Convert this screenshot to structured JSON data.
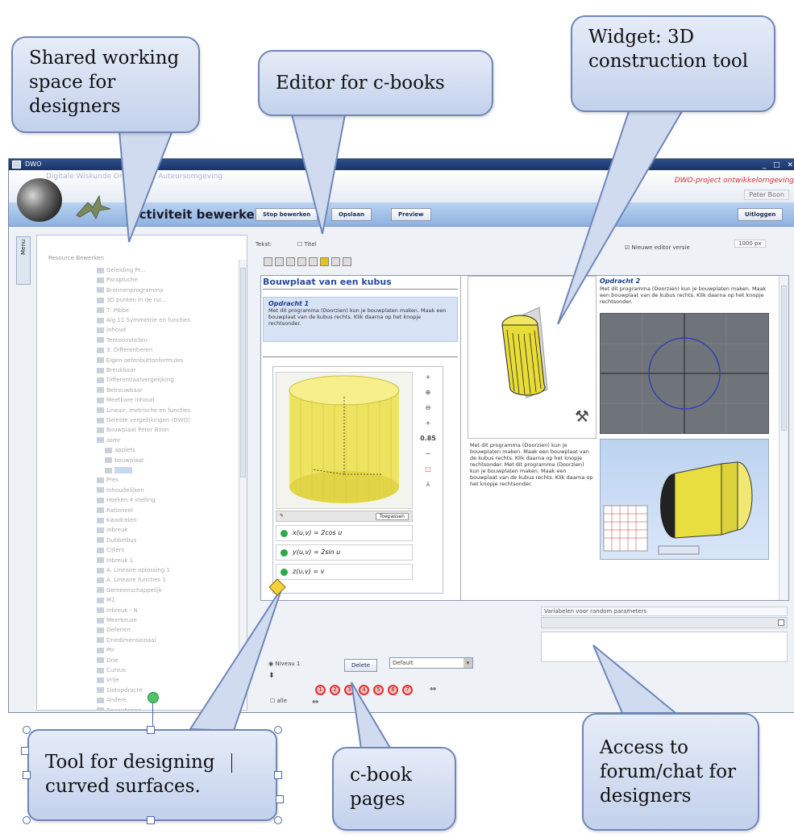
{
  "window": {
    "title": "DWO",
    "subtitle": "Digitale Wiskunde Omgeving - Auteursomgeving",
    "controls": "_ □ ✕",
    "project_title": "DWO-project ontwikkelomgeving",
    "user": "Peter Boon"
  },
  "toolbar": {
    "page_heading": "Activiteit bewerken",
    "stop_label": "Stop bewerken",
    "save_label": "Opslaan",
    "preview_label": "Preview",
    "logout_label": "Uitloggen"
  },
  "sidebar": {
    "tab_label": "Menu",
    "tree_tabs": "Resource   Bewerken",
    "items": [
      "Geleiding Pr...",
      "Parapluche",
      "Bronnenprogramma",
      "3D punten in de rui...",
      "7. Pibbe",
      "Alg 11 Symmetrie en functies",
      "Inhoud",
      "Tentoonstellen",
      "3. Differentieren",
      "Eigen oefenbuttonformules",
      "Breukbaar",
      "Differentiaalvergelijking",
      "Betrouwbaar",
      "Meetbare inhoud",
      "Lineair, metrische en functies",
      "Geleide vergelijkingen (DWO)",
      "Bouwplaat Peter Boon",
      "asmr",
      "applets",
      "bouwplaat",
      "",
      "Pres",
      "Inhoudelijken",
      "Hoeken 4 stelling",
      "Rationeel",
      "Kwadraten",
      "Inbreuk",
      "Dubbelbus",
      "Cijfers",
      "Inbreuk 1",
      "A. Lineaire oplossing 1",
      "A. Lineaire functies 1",
      "Gemeenschappelijk",
      "M1",
      "Inbreuk - N",
      "Meerkeuze",
      "Oefenen",
      "Driedimensionaal",
      "Ptr",
      "Drie",
      "Cursus",
      "Vrije",
      "Slotopdracht",
      "Andere",
      "Bouwstenen"
    ]
  },
  "editor": {
    "text_label": "Tekst:",
    "title_checkbox": "Titel",
    "new_editor_checkbox": "Nieuwe editor versie",
    "width_value": "1000 px",
    "page_title": "Bouwplaat van een kubus",
    "task1_heading": "Opdracht 1",
    "task1_body": "Met dit programma (Doorzien) kun je bouwplaten maken. Maak een bouwplaat van de kubus rechts. Klik daarna op het knopje rechtsonder.",
    "task2_heading": "Opdracht 2",
    "task2_body": "Met dit programma (Doorzien) kun je bouwplaten maken. Maak een bouwplaat van de kubus rechts. Klik daarna op het knopje rechtsonder.",
    "col2_text": "Met dit programma (Doorzien) kun je bouwplaten maken. Maak een bouwplaat van de kubus rechts. Klik daarna op het knopje rechtsonder. Met dit programma (Doorzien) kun je bouwplaten maken. Maak een bouwplaat van de kubus rechts. Klik daarna op het knopje rechtsonder.",
    "zoom_value": "0.85",
    "apply_label": "Toepassen",
    "equations": [
      "x(u,v) = 2cos u",
      "y(u,v) = 2sin u",
      "z(u,v) = v"
    ],
    "params_label": "Variabelen voor random parameters",
    "level_label": "Niveau 1",
    "delete_label": "Delete",
    "select_value": "Default",
    "all_label": "alle",
    "pages": [
      "1",
      "2",
      "3",
      "4",
      "5",
      "6",
      "7"
    ]
  },
  "callouts": {
    "shared": "Shared working space for designers",
    "editor": "Editor for c-books",
    "widget": "Widget: 3D construction tool",
    "tool": "Tool for designing curved surfaces.",
    "pages": "c-book pages",
    "forum": "Access to forum/chat for designers"
  },
  "colors": {
    "accent": "#2d4f8c",
    "callout_border": "#6f86b8",
    "surface_yellow": "#f0e860",
    "nav_blue": "#8fb2e0"
  }
}
